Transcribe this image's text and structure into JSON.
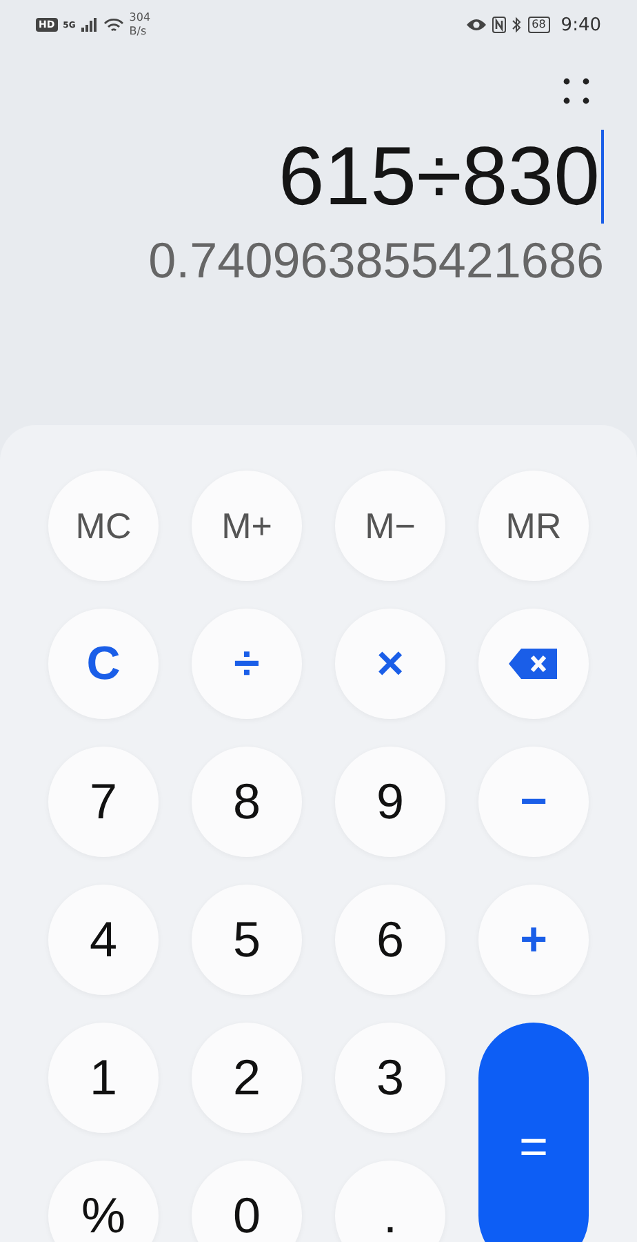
{
  "status_bar": {
    "hd": "HD",
    "network": "5G",
    "speed_value": "304",
    "speed_unit": "B/s",
    "battery": "68",
    "time": "9:40"
  },
  "display": {
    "expression": "615÷830",
    "result": "0.740963855421686"
  },
  "keys": [
    {
      "label": "MC",
      "kind": "memory"
    },
    {
      "label": "M+",
      "kind": "memory"
    },
    {
      "label": "M−",
      "kind": "memory"
    },
    {
      "label": "MR",
      "kind": "memory"
    },
    {
      "label": "C",
      "kind": "op"
    },
    {
      "label": "÷",
      "kind": "op"
    },
    {
      "label": "×",
      "kind": "op"
    },
    {
      "kind": "backspace"
    },
    {
      "label": "7",
      "kind": "digit"
    },
    {
      "label": "8",
      "kind": "digit"
    },
    {
      "label": "9",
      "kind": "digit"
    },
    {
      "label": "−",
      "kind": "op"
    },
    {
      "label": "4",
      "kind": "digit"
    },
    {
      "label": "5",
      "kind": "digit"
    },
    {
      "label": "6",
      "kind": "digit"
    },
    {
      "label": "+",
      "kind": "op"
    },
    {
      "label": "1",
      "kind": "digit"
    },
    {
      "label": "2",
      "kind": "digit"
    },
    {
      "label": "3",
      "kind": "digit"
    },
    {
      "label": "=",
      "kind": "equals"
    },
    {
      "label": "%",
      "kind": "digit"
    },
    {
      "label": "0",
      "kind": "digit"
    },
    {
      "label": ".",
      "kind": "digit"
    }
  ]
}
